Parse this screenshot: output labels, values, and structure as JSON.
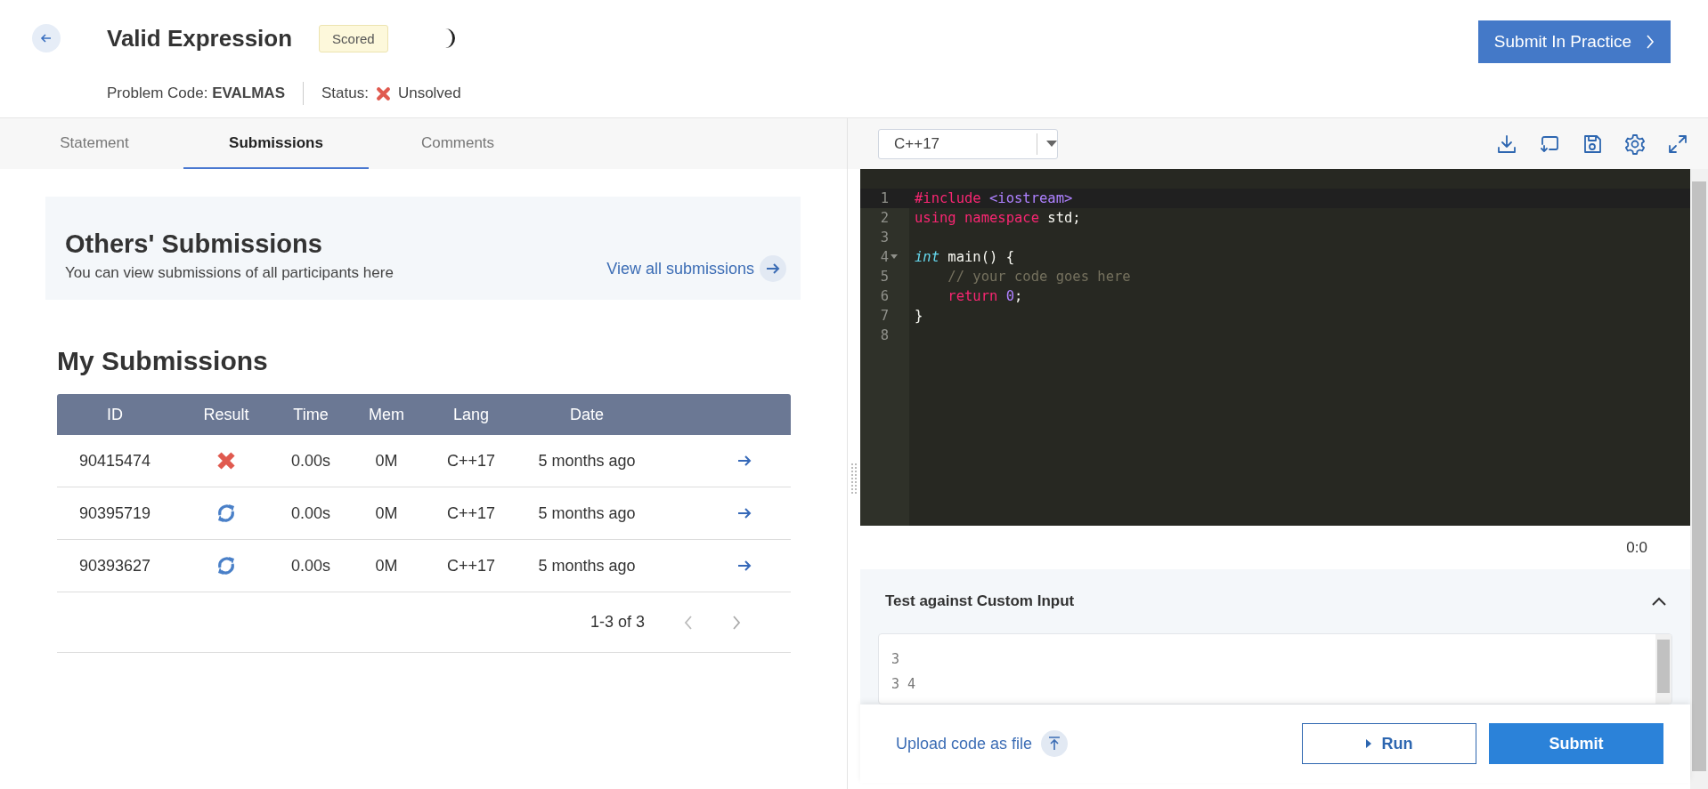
{
  "header": {
    "title": "Valid Expression",
    "badge": "Scored",
    "problem_code_label": "Problem Code:",
    "problem_code": "EVALMAS",
    "status_label": "Status:",
    "status": {
      "kind": "unsolved",
      "text": "Unsolved"
    },
    "primary_button": "Submit In Practice"
  },
  "tabs": [
    {
      "label": "Statement",
      "selected": false
    },
    {
      "label": "Submissions",
      "selected": true
    },
    {
      "label": "Comments",
      "selected": false
    }
  ],
  "editor_toolbar": {
    "language": "C++17"
  },
  "others_submissions": {
    "title": "Others' Submissions",
    "description": "You can view submissions of all participants here",
    "link": "View all submissions"
  },
  "my_submissions": {
    "title": "My Submissions",
    "columns": [
      "ID",
      "Result",
      "Time",
      "Mem",
      "Lang",
      "Date"
    ],
    "rows": [
      {
        "id": "90415474",
        "result": {
          "kind": "failed"
        },
        "time": "0.00s",
        "mem": "0M",
        "lang": "C++17",
        "date": "5 months ago"
      },
      {
        "id": "90395719",
        "result": {
          "kind": "pending"
        },
        "time": "0.00s",
        "mem": "0M",
        "lang": "C++17",
        "date": "5 months ago"
      },
      {
        "id": "90393627",
        "result": {
          "kind": "pending"
        },
        "time": "0.00s",
        "mem": "0M",
        "lang": "C++17",
        "date": "5 months ago"
      }
    ],
    "pagination": "1-3 of 3"
  },
  "editor": {
    "lines": [
      {
        "number": "1",
        "active": true,
        "fold": false,
        "tokens": [
          {
            "kind": "directive",
            "text": "#include "
          },
          {
            "kind": "string",
            "text": "<iostream>"
          }
        ]
      },
      {
        "number": "2",
        "active": false,
        "fold": false,
        "tokens": [
          {
            "kind": "keyword",
            "text": "using namespace "
          },
          {
            "kind": "plain",
            "text": "std;"
          }
        ]
      },
      {
        "number": "3",
        "active": false,
        "fold": false
      },
      {
        "number": "4",
        "active": false,
        "fold": true,
        "tokens": [
          {
            "kind": "type",
            "text": "int"
          },
          {
            "kind": "plain",
            "text": " main() {"
          }
        ]
      },
      {
        "number": "5",
        "active": false,
        "fold": false,
        "tokens": [
          {
            "kind": "comment",
            "text": "    // your code goes here"
          }
        ]
      },
      {
        "number": "6",
        "active": false,
        "fold": false,
        "tokens": [
          {
            "kind": "keyword",
            "text": "    return "
          },
          {
            "kind": "number",
            "text": "0"
          },
          {
            "kind": "plain",
            "text": ";"
          }
        ]
      },
      {
        "number": "7",
        "active": false,
        "fold": false,
        "tokens": [
          {
            "kind": "plain",
            "text": "}"
          }
        ]
      },
      {
        "number": "8",
        "active": false,
        "fold": false
      }
    ],
    "cursor_position": "0:0"
  },
  "custom_input": {
    "title": "Test against Custom Input",
    "expanded": true,
    "lines": [
      "3",
      "3 4"
    ]
  },
  "footer": {
    "upload_link": "Upload code as file",
    "run_button": "Run",
    "submit_button": "Submit"
  }
}
